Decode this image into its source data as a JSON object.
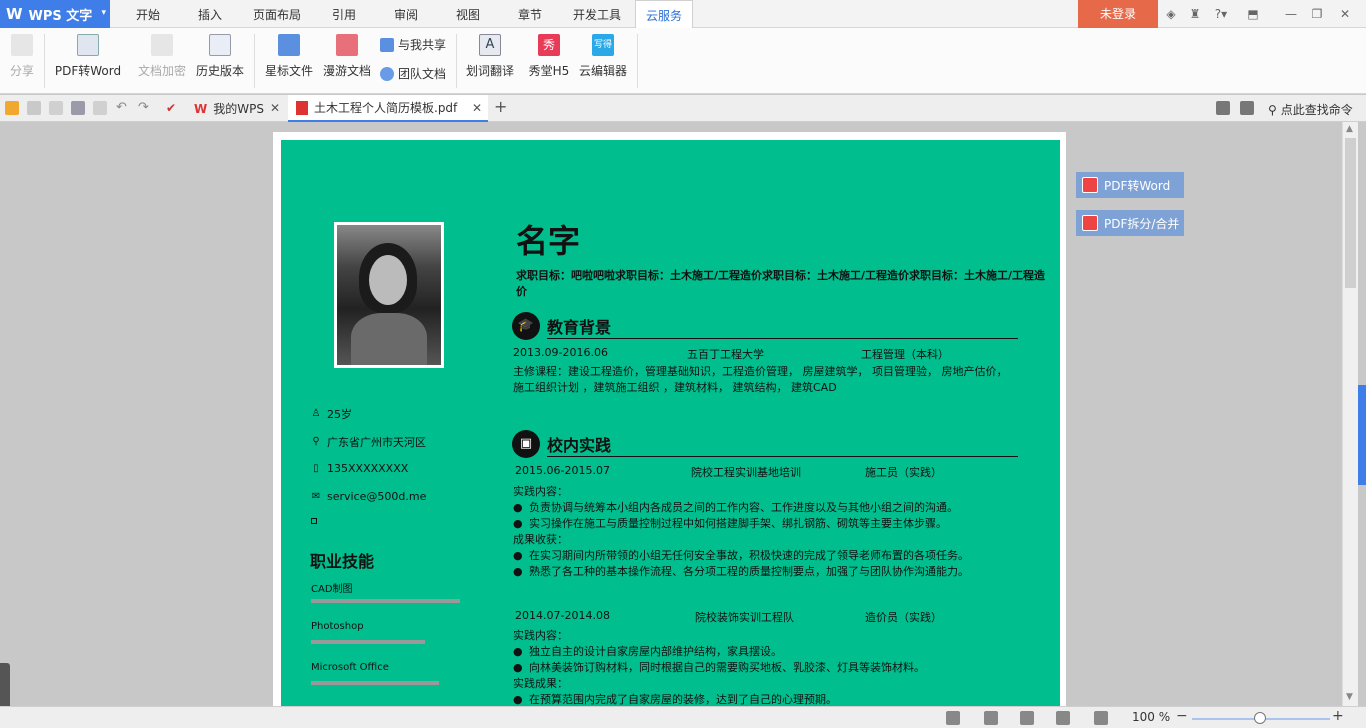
{
  "app": {
    "name": "WPS 文字",
    "login": "未登录"
  },
  "menu": {
    "tabs": [
      "开始",
      "插入",
      "页面布局",
      "引用",
      "审阅",
      "视图",
      "章节",
      "开发工具",
      "云服务"
    ],
    "active": "云服务"
  },
  "ribbon": {
    "share": "分享",
    "pdf_to_word": "PDF转Word",
    "doc_encrypt": "文档加密",
    "history": "历史版本",
    "star_files": "星标文件",
    "roam_docs": "漫游文档",
    "shared_with_me": "与我共享",
    "team_docs": "团队文档",
    "translate": "划词翻译",
    "xiutang": "秀堂H5",
    "cloud_editor": "云编辑器"
  },
  "tabs": {
    "wps": "我的WPS",
    "doc": "土木工程个人简历模板.pdf",
    "search": "点此查找命令"
  },
  "resume": {
    "name": "名字",
    "objective": "求职目标：吧啦吧啦求职目标：土木施工/工程造价求职目标：土木施工/工程造价求职目标：土木施工/工程造价",
    "age": "25岁",
    "address": "广东省广州市天河区",
    "phone": "135XXXXXXXX",
    "email": "service@500d.me",
    "skills_title": "职业技能",
    "skills": [
      {
        "name": "CAD制图",
        "level": 0.85
      },
      {
        "name": "Photoshop",
        "level": 0.65
      },
      {
        "name": "Microsoft Office",
        "level": 0.73
      }
    ],
    "edu": {
      "title": "教育背景",
      "date": "2013.09-2016.06",
      "school": "五百丁工程大学",
      "major": "工程管理（本科）",
      "courses_1": "主修课程：建设工程造价，管理基础知识，工程造价管理， 房屋建筑学， 项目管理验， 房地产估价，",
      "courses_2": "施工组织计划 ，建筑施工组织 ，建筑材料， 建筑结构， 建筑CAD"
    },
    "practice": {
      "title": "校内实践",
      "p1": {
        "date": "2015.06-2015.07",
        "org": "院校工程实训基地培训",
        "role": "施工员（实践）",
        "content_label": "实践内容：",
        "c1": "负责协调与统筹本小组内各成员之间的工作内容、工作进度以及与其他小组之间的沟通。",
        "c2": "实习操作在施工与质量控制过程中如何搭建脚手架、绑扎钢筋、砌筑等主要主体步骤。",
        "result_label": "成果收获：",
        "r1": "在实习期间内所带领的小组无任何安全事故，积极快速的完成了领导老师布置的各项任务。",
        "r2": "熟悉了各工种的基本操作流程、各分项工程的质量控制要点，加强了与团队协作沟通能力。"
      },
      "p2": {
        "date": "2014.07-2014.08",
        "org": "院校装饰实训工程队",
        "role": "造价员（实践）",
        "content_label": "实践内容：",
        "c1": "独立自主的设计自家房屋内部维护结构，家具摆设。",
        "c2": "向林美装饰订购材料，同时根据自己的需要购买地板、乳胶漆、灯具等装饰材料。",
        "result_label": "实践成果：",
        "r1": "在预算范围内完成了自家房屋的装修，达到了自己的心理预期。"
      }
    }
  },
  "side": {
    "pdf_to_word": "PDF转Word",
    "pdf_split": "PDF拆分/合并"
  },
  "status": {
    "zoom": "100 %"
  },
  "colors": {
    "accent": "#3f7ee8",
    "resume_bg": "#01be8e",
    "login": "#e66a4a"
  }
}
